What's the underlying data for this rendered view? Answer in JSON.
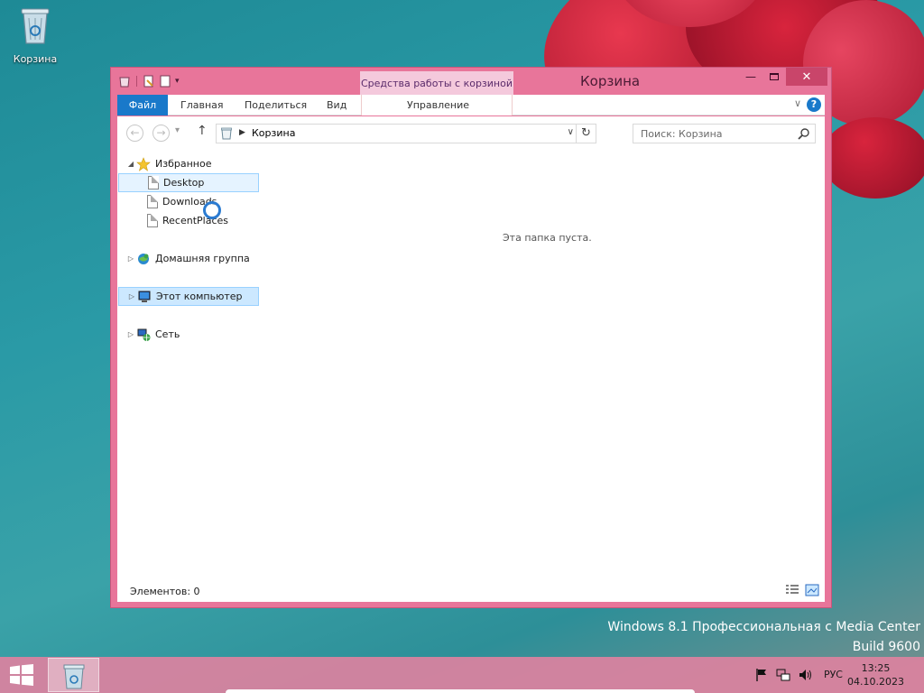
{
  "desktop": {
    "icons": [
      {
        "label": "Корзина"
      }
    ],
    "watermark": [
      "Windows 8.1 Профессиональная с Media Center",
      "Build 9600"
    ]
  },
  "window": {
    "title": "Корзина",
    "context_tab_header": "Средства работы с корзиной",
    "ribbon_tabs": [
      "Файл",
      "Главная",
      "Поделиться",
      "Вид",
      "Управление"
    ],
    "address_path": "Корзина",
    "search_placeholder": "Поиск: Корзина",
    "empty_message": "Эта папка пуста.",
    "status": "Элементов: 0",
    "nav_tree": {
      "favorites": {
        "label": "Избранное",
        "items": [
          "Desktop",
          "Downloads",
          "RecentPlaces"
        ]
      },
      "homegroup": "Домашняя группа",
      "this_pc": "Этот компьютер",
      "network": "Сеть"
    }
  },
  "taskbar": {
    "language": "РУС",
    "time": "13:25",
    "date": "04.10.2023"
  },
  "colors": {
    "window_frame": "#e8759a",
    "file_tab": "#1979ca",
    "context_tab": "#f4c9dc",
    "selection": "#cce8ff"
  }
}
